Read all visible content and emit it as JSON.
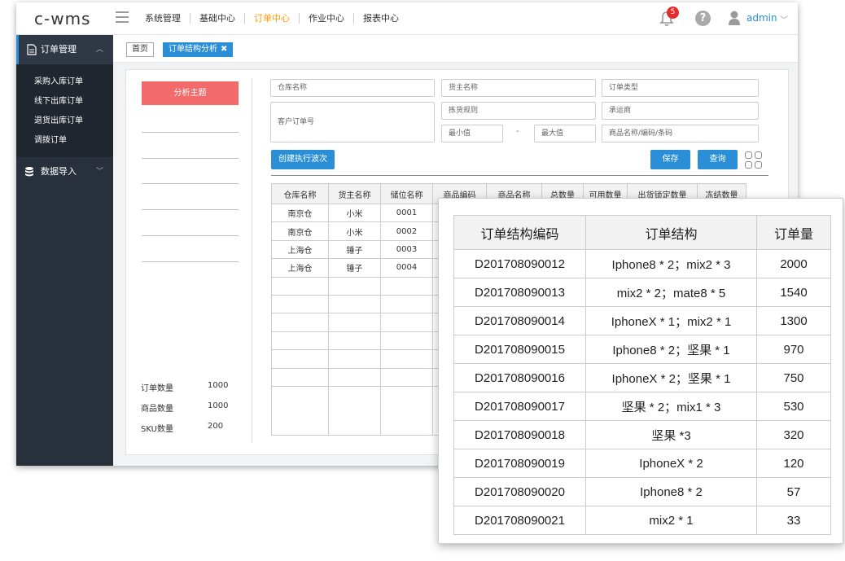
{
  "app": {
    "logo": "c-wms"
  },
  "topnav": {
    "items": [
      "系统管理",
      "基础中心",
      "订单中心",
      "作业中心",
      "报表中心"
    ],
    "active_index": 2
  },
  "header": {
    "notification_count": "5",
    "help": "?",
    "user": "admin"
  },
  "sidebar": {
    "group1": "订单管理",
    "sub_items": [
      "采购入库订单",
      "线下出库订单",
      "退货出库订单",
      "调拨订单"
    ],
    "group2": "数据导入"
  },
  "tabs": {
    "home": "首页",
    "current": "订单结构分析",
    "close": "✖"
  },
  "analysis": {
    "topic_button": "分析主题",
    "stats": [
      {
        "label": "订单数量",
        "value": "1000"
      },
      {
        "label": "商品数量",
        "value": "1000"
      },
      {
        "label": "SKU数量",
        "value": "200"
      }
    ]
  },
  "filters": {
    "warehouse": "仓库名称",
    "owner": "货主名称",
    "order_type": "订单类型",
    "customer_order": "客户订单号",
    "picking_rule": "拣货规则",
    "carrier": "承运商",
    "min": "最小值",
    "dash": "-",
    "max": "最大值",
    "product": "商品名称/编码/条码"
  },
  "buttons": {
    "create_wave": "创建执行波次",
    "save": "保存",
    "query": "查询"
  },
  "data_table": {
    "columns": [
      "仓库名称",
      "货主名称",
      "储位名称",
      "商品编码",
      "商品名称",
      "总数量",
      "可用数量",
      "出货锁定数量",
      "冻结数量"
    ],
    "rows": [
      [
        "南京仓",
        "小米",
        "0001",
        "",
        "",
        "",
        "",
        "",
        ""
      ],
      [
        "南京仓",
        "小米",
        "0002",
        "",
        "",
        "",
        "",
        "",
        ""
      ],
      [
        "上海仓",
        "锤子",
        "0003",
        "",
        "",
        "",
        "",
        "",
        ""
      ],
      [
        "上海仓",
        "锤子",
        "0004",
        "",
        "",
        "",
        "",
        "",
        ""
      ]
    ]
  },
  "structure_table": {
    "columns": [
      "订单结构编码",
      "订单结构",
      "订单量"
    ],
    "rows": [
      [
        "D201708090012",
        "Iphone8 * 2；mix2 * 3",
        "2000"
      ],
      [
        "D201708090013",
        "mix2 * 2；mate8 * 5",
        "1540"
      ],
      [
        "D201708090014",
        "IphoneX * 1；mix2 * 1",
        "1300"
      ],
      [
        "D201708090015",
        "Iphone8 * 2；坚果 * 1",
        "970"
      ],
      [
        "D201708090016",
        "IphoneX * 2；坚果 * 1",
        "750"
      ],
      [
        "D201708090017",
        "坚果 * 2；mix1 * 3",
        "530"
      ],
      [
        "D201708090018",
        "坚果 *3",
        "320"
      ],
      [
        "D201708090019",
        "IphoneX * 2",
        "120"
      ],
      [
        "D201708090020",
        "Iphone8 * 2",
        "57"
      ],
      [
        "D201708090021",
        "mix2 * 1",
        "33"
      ]
    ]
  }
}
